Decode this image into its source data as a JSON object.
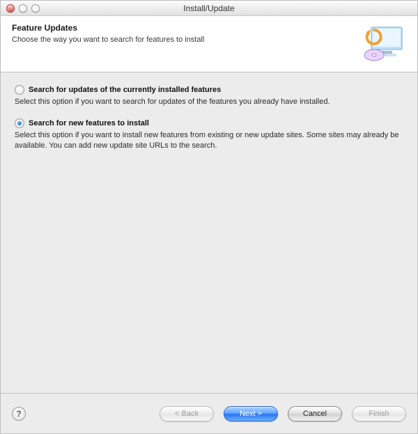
{
  "window": {
    "title": "Install/Update"
  },
  "header": {
    "title": "Feature Updates",
    "subtitle": "Choose the way you want to search for features to install"
  },
  "options": [
    {
      "id": "updates-existing",
      "label": "Search for updates of the currently installed features",
      "description": "Select this option if you want to search for updates of the features you already have installed.",
      "selected": false
    },
    {
      "id": "new-features",
      "label": "Search for new features to install",
      "description": "Select this option if you want to install new features from existing or new update sites. Some sites may already be available. You can add new update site URLs to the search.",
      "selected": true
    }
  ],
  "footer": {
    "help_glyph": "?",
    "buttons": {
      "back": {
        "label": "< Back",
        "enabled": false
      },
      "next": {
        "label": "Next >",
        "enabled": true,
        "primary": true
      },
      "cancel": {
        "label": "Cancel",
        "enabled": true
      },
      "finish": {
        "label": "Finish",
        "enabled": false
      }
    }
  }
}
